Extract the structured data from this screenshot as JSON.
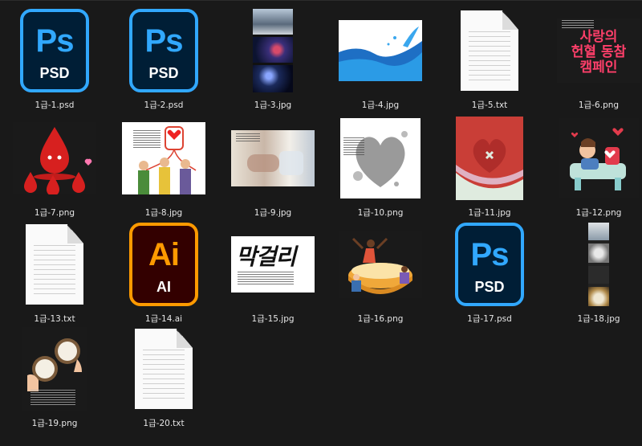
{
  "files": [
    {
      "name": "1급-1.psd",
      "type": "psd",
      "badge": "Ps",
      "ext_label": "PSD"
    },
    {
      "name": "1급-2.psd",
      "type": "psd",
      "badge": "Ps",
      "ext_label": "PSD"
    },
    {
      "name": "1급-3.jpg",
      "type": "jpg"
    },
    {
      "name": "1급-4.jpg",
      "type": "jpg"
    },
    {
      "name": "1급-5.txt",
      "type": "txt"
    },
    {
      "name": "1급-6.png",
      "type": "png",
      "thumb_text": [
        "사랑의",
        "헌혈 동참",
        "캠페인"
      ]
    },
    {
      "name": "1급-7.png",
      "type": "png"
    },
    {
      "name": "1급-8.jpg",
      "type": "jpg"
    },
    {
      "name": "1급-9.jpg",
      "type": "jpg"
    },
    {
      "name": "1급-10.png",
      "type": "png"
    },
    {
      "name": "1급-11.jpg",
      "type": "jpg"
    },
    {
      "name": "1급-12.png",
      "type": "png"
    },
    {
      "name": "1급-13.txt",
      "type": "txt"
    },
    {
      "name": "1급-14.ai",
      "type": "ai",
      "badge": "Ai",
      "ext_label": "AI"
    },
    {
      "name": "1급-15.jpg",
      "type": "jpg",
      "thumb_text": "막걸리"
    },
    {
      "name": "1급-16.png",
      "type": "png"
    },
    {
      "name": "1급-17.psd",
      "type": "psd",
      "badge": "Ps",
      "ext_label": "PSD"
    },
    {
      "name": "1급-18.jpg",
      "type": "jpg"
    },
    {
      "name": "1급-19.png",
      "type": "png"
    },
    {
      "name": "1급-20.txt",
      "type": "txt"
    }
  ],
  "colors": {
    "background": "#191919",
    "label_text": "#e6e6e6",
    "photoshop_accent": "#31a8ff",
    "photoshop_bg": "#001e36",
    "illustrator_accent": "#ff9a00",
    "illustrator_bg": "#330000"
  }
}
